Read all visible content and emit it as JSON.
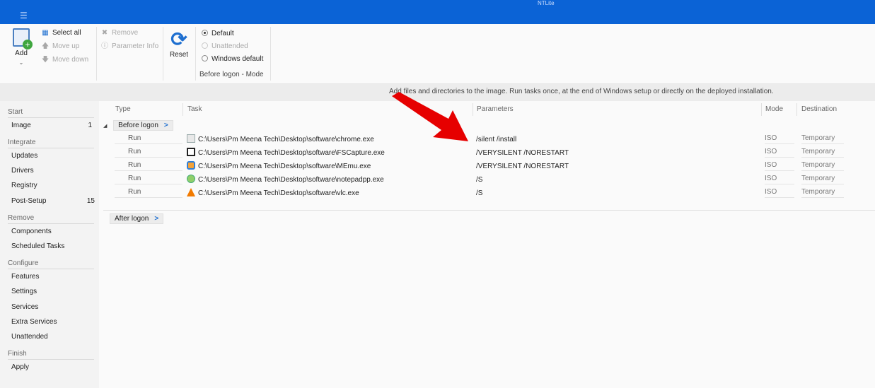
{
  "titlebar": {
    "menu_icon": "hamburger-icon",
    "title": "NTLite"
  },
  "ribbon": {
    "add_label": "Add",
    "select_all": "Select all",
    "move_up": "Move up",
    "move_down": "Move down",
    "remove": "Remove",
    "parameter_info": "Parameter Info",
    "reset": "Reset",
    "modes": [
      "Default",
      "Unattended",
      "Windows default"
    ],
    "selected_mode": "Default",
    "group_label": "Before logon - Mode"
  },
  "info": "Add files and directories to the image. Run tasks once, at the end of Windows setup or directly on the deployed installation.",
  "sidebar": {
    "start": "Start",
    "image": "Image",
    "image_count": "1",
    "integrate": "Integrate",
    "updates": "Updates",
    "drivers": "Drivers",
    "registry": "Registry",
    "post_setup": "Post-Setup",
    "post_setup_count": "15",
    "remove": "Remove",
    "components": "Components",
    "scheduled_tasks": "Scheduled Tasks",
    "configure": "Configure",
    "features": "Features",
    "settings": "Settings",
    "services": "Services",
    "extra_services": "Extra Services",
    "unattended": "Unattended",
    "finish": "Finish",
    "apply": "Apply"
  },
  "table": {
    "headers": {
      "type": "Type",
      "task": "Task",
      "parameters": "Parameters",
      "mode": "Mode",
      "destination": "Destination"
    },
    "before_logon": "Before logon",
    "after_logon": "After logon",
    "rows": [
      {
        "type": "Run",
        "task": "C:\\Users\\Pm Meena Tech\\Desktop\\software\\chrome.exe",
        "parameters": "/silent /install",
        "mode": "ISO",
        "destination": "Temporary",
        "icon": "chrome-installer-icon"
      },
      {
        "type": "Run",
        "task": "C:\\Users\\Pm Meena Tech\\Desktop\\software\\FSCapture.exe",
        "parameters": "/VERYSILENT /NORESTART",
        "mode": "ISO",
        "destination": "Temporary",
        "icon": "fscapture-icon"
      },
      {
        "type": "Run",
        "task": "C:\\Users\\Pm Meena Tech\\Desktop\\software\\MEmu.exe",
        "parameters": "/VERYSILENT /NORESTART",
        "mode": "ISO",
        "destination": "Temporary",
        "icon": "memu-icon"
      },
      {
        "type": "Run",
        "task": "C:\\Users\\Pm Meena Tech\\Desktop\\software\\notepadpp.exe",
        "parameters": "/S",
        "mode": "ISO",
        "destination": "Temporary",
        "icon": "notepadpp-icon"
      },
      {
        "type": "Run",
        "task": "C:\\Users\\Pm Meena Tech\\Desktop\\software\\vlc.exe",
        "parameters": "/S",
        "mode": "ISO",
        "destination": "Temporary",
        "icon": "vlc-icon"
      }
    ]
  },
  "colors": {
    "titlebar": "#0b63d6",
    "accent": "#1e6fd0",
    "arrow": "#e60000"
  }
}
